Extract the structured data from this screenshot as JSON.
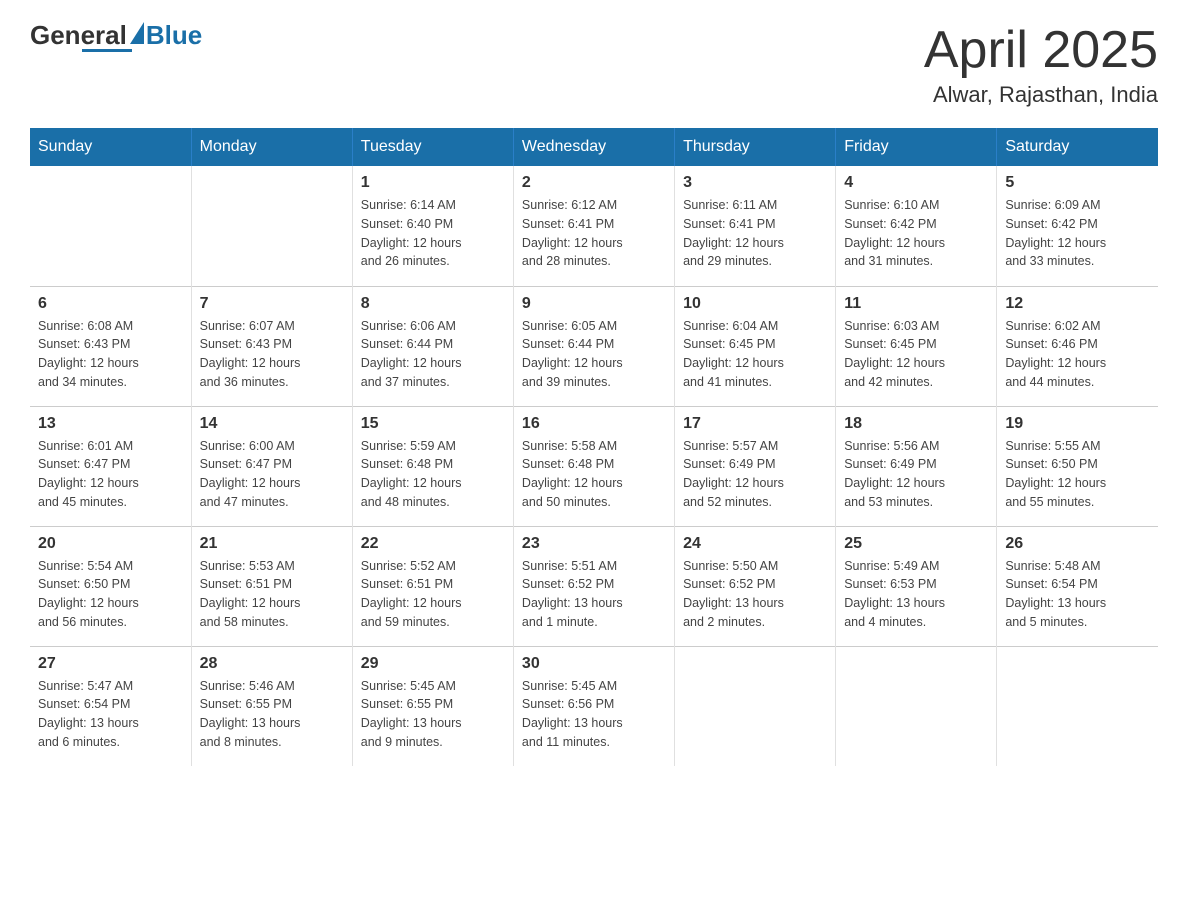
{
  "logo": {
    "general": "General",
    "blue": "Blue"
  },
  "header": {
    "month": "April 2025",
    "location": "Alwar, Rajasthan, India"
  },
  "days_of_week": [
    "Sunday",
    "Monday",
    "Tuesday",
    "Wednesday",
    "Thursday",
    "Friday",
    "Saturday"
  ],
  "weeks": [
    [
      {
        "day": "",
        "info": ""
      },
      {
        "day": "",
        "info": ""
      },
      {
        "day": "1",
        "info": "Sunrise: 6:14 AM\nSunset: 6:40 PM\nDaylight: 12 hours\nand 26 minutes."
      },
      {
        "day": "2",
        "info": "Sunrise: 6:12 AM\nSunset: 6:41 PM\nDaylight: 12 hours\nand 28 minutes."
      },
      {
        "day": "3",
        "info": "Sunrise: 6:11 AM\nSunset: 6:41 PM\nDaylight: 12 hours\nand 29 minutes."
      },
      {
        "day": "4",
        "info": "Sunrise: 6:10 AM\nSunset: 6:42 PM\nDaylight: 12 hours\nand 31 minutes."
      },
      {
        "day": "5",
        "info": "Sunrise: 6:09 AM\nSunset: 6:42 PM\nDaylight: 12 hours\nand 33 minutes."
      }
    ],
    [
      {
        "day": "6",
        "info": "Sunrise: 6:08 AM\nSunset: 6:43 PM\nDaylight: 12 hours\nand 34 minutes."
      },
      {
        "day": "7",
        "info": "Sunrise: 6:07 AM\nSunset: 6:43 PM\nDaylight: 12 hours\nand 36 minutes."
      },
      {
        "day": "8",
        "info": "Sunrise: 6:06 AM\nSunset: 6:44 PM\nDaylight: 12 hours\nand 37 minutes."
      },
      {
        "day": "9",
        "info": "Sunrise: 6:05 AM\nSunset: 6:44 PM\nDaylight: 12 hours\nand 39 minutes."
      },
      {
        "day": "10",
        "info": "Sunrise: 6:04 AM\nSunset: 6:45 PM\nDaylight: 12 hours\nand 41 minutes."
      },
      {
        "day": "11",
        "info": "Sunrise: 6:03 AM\nSunset: 6:45 PM\nDaylight: 12 hours\nand 42 minutes."
      },
      {
        "day": "12",
        "info": "Sunrise: 6:02 AM\nSunset: 6:46 PM\nDaylight: 12 hours\nand 44 minutes."
      }
    ],
    [
      {
        "day": "13",
        "info": "Sunrise: 6:01 AM\nSunset: 6:47 PM\nDaylight: 12 hours\nand 45 minutes."
      },
      {
        "day": "14",
        "info": "Sunrise: 6:00 AM\nSunset: 6:47 PM\nDaylight: 12 hours\nand 47 minutes."
      },
      {
        "day": "15",
        "info": "Sunrise: 5:59 AM\nSunset: 6:48 PM\nDaylight: 12 hours\nand 48 minutes."
      },
      {
        "day": "16",
        "info": "Sunrise: 5:58 AM\nSunset: 6:48 PM\nDaylight: 12 hours\nand 50 minutes."
      },
      {
        "day": "17",
        "info": "Sunrise: 5:57 AM\nSunset: 6:49 PM\nDaylight: 12 hours\nand 52 minutes."
      },
      {
        "day": "18",
        "info": "Sunrise: 5:56 AM\nSunset: 6:49 PM\nDaylight: 12 hours\nand 53 minutes."
      },
      {
        "day": "19",
        "info": "Sunrise: 5:55 AM\nSunset: 6:50 PM\nDaylight: 12 hours\nand 55 minutes."
      }
    ],
    [
      {
        "day": "20",
        "info": "Sunrise: 5:54 AM\nSunset: 6:50 PM\nDaylight: 12 hours\nand 56 minutes."
      },
      {
        "day": "21",
        "info": "Sunrise: 5:53 AM\nSunset: 6:51 PM\nDaylight: 12 hours\nand 58 minutes."
      },
      {
        "day": "22",
        "info": "Sunrise: 5:52 AM\nSunset: 6:51 PM\nDaylight: 12 hours\nand 59 minutes."
      },
      {
        "day": "23",
        "info": "Sunrise: 5:51 AM\nSunset: 6:52 PM\nDaylight: 13 hours\nand 1 minute."
      },
      {
        "day": "24",
        "info": "Sunrise: 5:50 AM\nSunset: 6:52 PM\nDaylight: 13 hours\nand 2 minutes."
      },
      {
        "day": "25",
        "info": "Sunrise: 5:49 AM\nSunset: 6:53 PM\nDaylight: 13 hours\nand 4 minutes."
      },
      {
        "day": "26",
        "info": "Sunrise: 5:48 AM\nSunset: 6:54 PM\nDaylight: 13 hours\nand 5 minutes."
      }
    ],
    [
      {
        "day": "27",
        "info": "Sunrise: 5:47 AM\nSunset: 6:54 PM\nDaylight: 13 hours\nand 6 minutes."
      },
      {
        "day": "28",
        "info": "Sunrise: 5:46 AM\nSunset: 6:55 PM\nDaylight: 13 hours\nand 8 minutes."
      },
      {
        "day": "29",
        "info": "Sunrise: 5:45 AM\nSunset: 6:55 PM\nDaylight: 13 hours\nand 9 minutes."
      },
      {
        "day": "30",
        "info": "Sunrise: 5:45 AM\nSunset: 6:56 PM\nDaylight: 13 hours\nand 11 minutes."
      },
      {
        "day": "",
        "info": ""
      },
      {
        "day": "",
        "info": ""
      },
      {
        "day": "",
        "info": ""
      }
    ]
  ]
}
